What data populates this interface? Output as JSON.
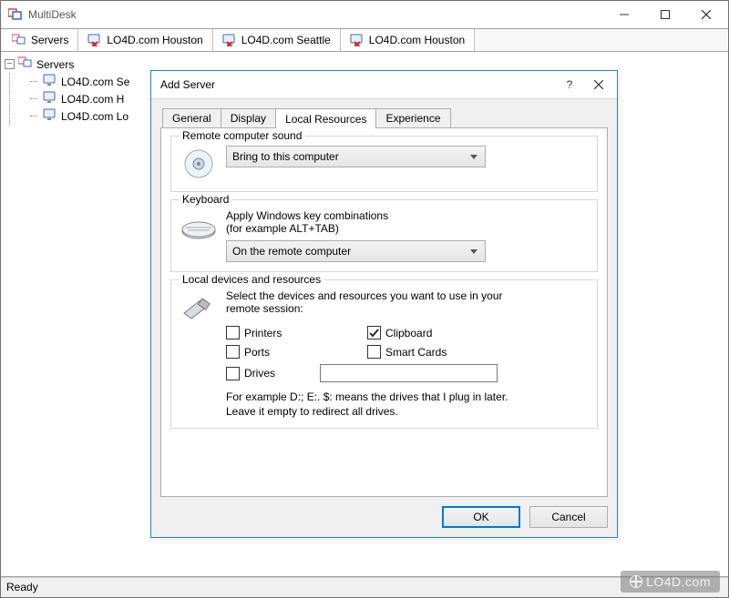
{
  "window": {
    "title": "MultiDesk"
  },
  "tabs": [
    {
      "label": "Servers",
      "icon": "servers"
    },
    {
      "label": "LO4D.com Houston",
      "icon": "monitor-x"
    },
    {
      "label": "LO4D.com Seattle",
      "icon": "monitor-x"
    },
    {
      "label": "LO4D.com Houston",
      "icon": "monitor-x"
    }
  ],
  "tree": {
    "root": "Servers",
    "items": [
      "LO4D.com Se",
      "LO4D.com H",
      "LO4D.com Lo"
    ]
  },
  "statusbar": {
    "text": "Ready"
  },
  "dialog": {
    "title": "Add Server",
    "help": "?",
    "tabs": {
      "general": "General",
      "display": "Display",
      "local": "Local Resources",
      "experience": "Experience"
    },
    "active_tab": "local",
    "sound": {
      "group_title": "Remote computer sound",
      "selected": "Bring to this computer"
    },
    "keyboard": {
      "group_title": "Keyboard",
      "desc_line1": "Apply Windows key combinations",
      "desc_line2": "(for example ALT+TAB)",
      "selected": "On the remote computer"
    },
    "devices": {
      "group_title": "Local devices and resources",
      "desc_line1": "Select the devices and resources you want to use in your",
      "desc_line2": "remote session:",
      "printers": "Printers",
      "clipboard": "Clipboard",
      "ports": "Ports",
      "smartcards": "Smart Cards",
      "drives": "Drives",
      "drives_value": "",
      "help_line1": "For example D:; E:. $: means the drives that I plug in later.",
      "help_line2": "Leave it empty to redirect all drives.",
      "checked": {
        "printers": false,
        "clipboard": true,
        "ports": false,
        "smartcards": false,
        "drives": false
      }
    },
    "buttons": {
      "ok": "OK",
      "cancel": "Cancel"
    }
  },
  "watermark": "LO4D.com"
}
